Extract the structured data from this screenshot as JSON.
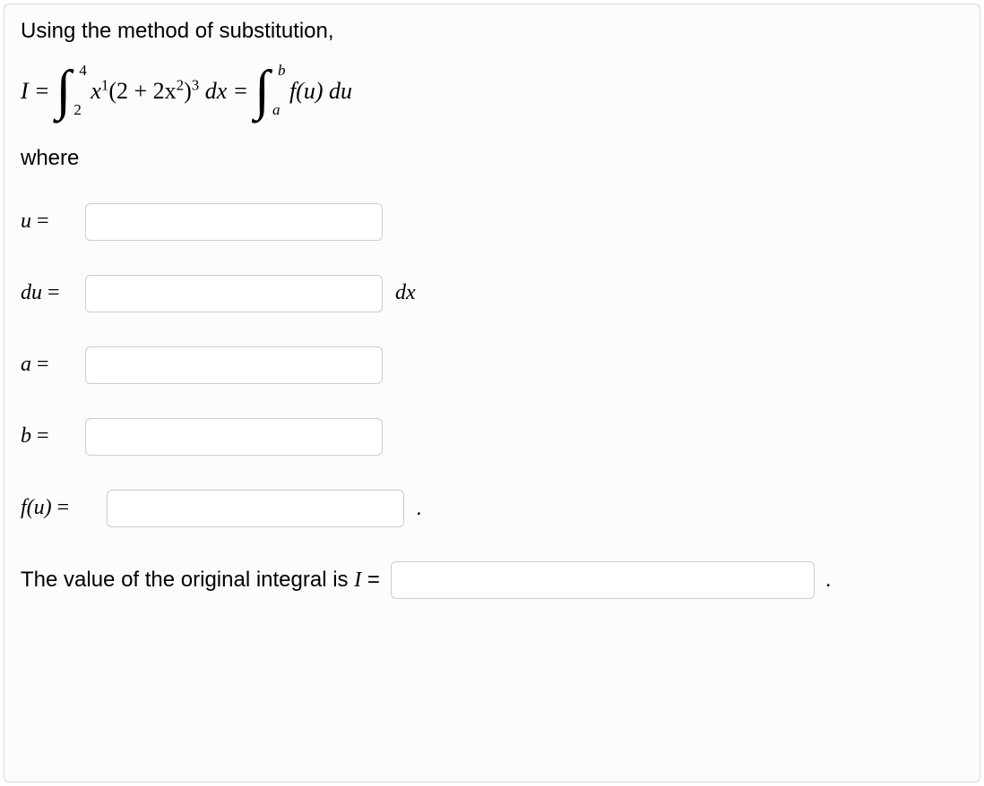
{
  "intro": "Using the method of substitution,",
  "equation": {
    "lhs": "I",
    "eq1": "=",
    "int1_lower": "2",
    "int1_upper": "4",
    "integrand1_pre": "x",
    "integrand1_exp1": "1",
    "integrand1_paren_a": "(2 + 2x",
    "integrand1_exp2": "2",
    "integrand1_paren_b": ")",
    "integrand1_exp3": "3",
    "dx": " dx",
    "eq2": "=",
    "int2_lower": "a",
    "int2_upper": "b",
    "integrand2": "f(u) du"
  },
  "where": "where",
  "fields": {
    "u_label": "u",
    "du_label": "du",
    "du_suffix": "dx",
    "a_label": "a",
    "b_label": "b",
    "fu_label": "f(u)"
  },
  "final": {
    "text_pre": "The value of the original integral is ",
    "I": "I",
    "eq": "="
  },
  "symbols": {
    "equals": "=",
    "period": "."
  }
}
